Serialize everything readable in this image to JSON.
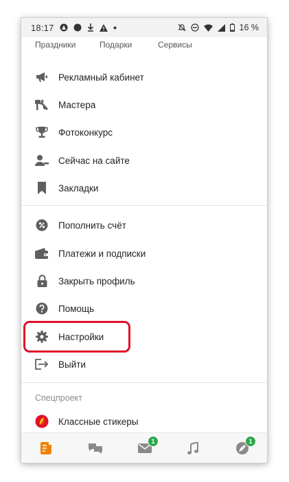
{
  "status_bar": {
    "time": "18:17",
    "battery": "16 %",
    "left_icons": [
      "assistant-icon",
      "circle-icon",
      "download-icon",
      "warning-icon",
      "dot-icon"
    ],
    "right_icons": [
      "alarm-off-icon",
      "dnd-icon",
      "wifi-icon",
      "signal-icon",
      "battery-icon"
    ]
  },
  "top_tabs": [
    "Праздники",
    "Подарки",
    "Сервисы"
  ],
  "menu_group_1": [
    {
      "label": "Рекламный кабинет",
      "icon": "megaphone-icon"
    },
    {
      "label": "Мастера",
      "icon": "tools-icon"
    },
    {
      "label": "Фотоконкурс",
      "icon": "trophy-icon"
    },
    {
      "label": "Сейчас на сайте",
      "icon": "users-online-icon"
    },
    {
      "label": "Закладки",
      "icon": "bookmark-icon"
    }
  ],
  "menu_group_2": [
    {
      "label": "Пополнить счёт",
      "icon": "coin-icon"
    },
    {
      "label": "Платежи и подписки",
      "icon": "wallet-icon"
    },
    {
      "label": "Закрыть профиль",
      "icon": "lock-icon"
    },
    {
      "label": "Помощь",
      "icon": "help-icon"
    },
    {
      "label": "Настройки",
      "icon": "gear-icon"
    },
    {
      "label": "Выйти",
      "icon": "logout-icon"
    }
  ],
  "special_section": {
    "title": "Спецпроект",
    "items": [
      {
        "label": "Классные стикеры",
        "icon": "stickers-icon"
      }
    ]
  },
  "bottom_nav": [
    {
      "icon": "feed-icon",
      "badge": ""
    },
    {
      "icon": "chats-icon",
      "badge": ""
    },
    {
      "icon": "notifications-icon",
      "badge": "1"
    },
    {
      "icon": "music-icon",
      "badge": ""
    },
    {
      "icon": "discussions-icon",
      "badge": "1"
    }
  ],
  "colors": {
    "accent": "#ee8208",
    "icon_gray": "#5f5f5f",
    "badge_green": "#2ca84a",
    "highlight_red": "#e0102a"
  }
}
